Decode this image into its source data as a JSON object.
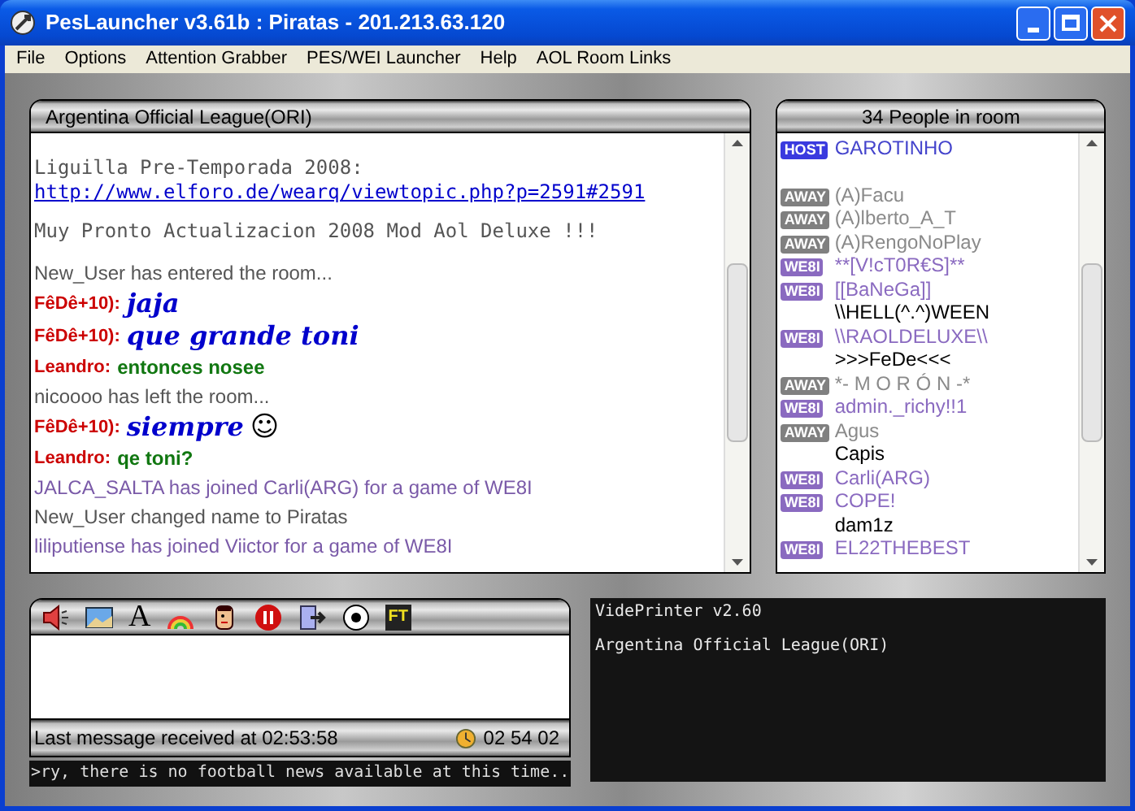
{
  "window": {
    "title": "PesLauncher v3.61b : Piratas - 201.213.63.120"
  },
  "menu": [
    "File",
    "Options",
    "Attention Grabber",
    "PES/WEI Launcher",
    "Help",
    "AOL Room Links"
  ],
  "chat": {
    "title": "Argentina Official League(ORI)",
    "messages": [
      {
        "kind": "announce",
        "text": "Liguilla Pre-Temporada 2008:",
        "link": "http://www.elforo.de/wearq/viewtopic.php?p=2591#2591"
      },
      {
        "kind": "announce",
        "text": "Muy Pronto Actualizacion 2008 Mod Aol Deluxe !!!"
      },
      {
        "kind": "system",
        "text": "New_User has entered the room..."
      },
      {
        "kind": "fancy",
        "user": "FêDê+10):",
        "text": "jaja"
      },
      {
        "kind": "fancy",
        "user": "FêDê+10):",
        "text": "que grande toni"
      },
      {
        "kind": "plain",
        "user": "Leandro:",
        "text": "entonces nosee"
      },
      {
        "kind": "system",
        "text": "nicoooo has left the room..."
      },
      {
        "kind": "fancy",
        "user": "FêDê+10):",
        "text": "siempre",
        "emoticon": "☺"
      },
      {
        "kind": "plain",
        "user": "Leandro:",
        "text": "qe toni?"
      },
      {
        "kind": "game",
        "text": "JALCA_SALTA has joined Carli(ARG) for a game of WE8I"
      },
      {
        "kind": "system",
        "text": "New_User changed name to Piratas"
      },
      {
        "kind": "game",
        "text": "liliputiense has joined Viictor for a game of WE8I"
      }
    ]
  },
  "people": {
    "title": "34 People in room",
    "users": [
      {
        "badge": "HOST",
        "kind": "host",
        "name": "GAROTINHO"
      },
      {
        "kind": "spacer"
      },
      {
        "badge": "AWAY",
        "kind": "away",
        "name": "(A)Facu"
      },
      {
        "badge": "AWAY",
        "kind": "away",
        "name": "(A)lberto_A_T"
      },
      {
        "badge": "AWAY",
        "kind": "away",
        "name": "(A)RengoNoPlay"
      },
      {
        "badge": "WE8I",
        "kind": "playing",
        "name": "**[V!cT0R€S]**"
      },
      {
        "badge": "WE8I",
        "kind": "playing",
        "name": "[[BaNeGa]]"
      },
      {
        "kind": "idle",
        "name": "\\\\HELL(^.^)WEEN"
      },
      {
        "badge": "WE8I",
        "kind": "playing",
        "name": "\\\\RAOLDELUXE\\\\"
      },
      {
        "kind": "idle",
        "name": ">>>FeDe<<<"
      },
      {
        "badge": "AWAY",
        "kind": "away",
        "name": "*- M O R Ó N -*"
      },
      {
        "badge": "WE8I",
        "kind": "playing",
        "name": "admin._richy!!1"
      },
      {
        "badge": "AWAY",
        "kind": "away",
        "name": "Agus"
      },
      {
        "kind": "idle",
        "name": "Capis"
      },
      {
        "badge": "WE8I",
        "kind": "playing",
        "name": "Carli(ARG)"
      },
      {
        "badge": "WE8I",
        "kind": "playing",
        "name": "COPE!"
      },
      {
        "kind": "idle",
        "name": "dam1z"
      },
      {
        "badge": "WE8I",
        "kind": "playing",
        "name": "EL22THEBEST"
      }
    ]
  },
  "input_panel": {
    "toolbar": {
      "font_glyph": "A",
      "ft_label": "FT"
    },
    "status": "Last message received at 02:53:58",
    "clock": "02 54 02",
    "ticker": ">ry, there is no football news available at this time.."
  },
  "videprinter": {
    "lines": [
      "VidePrinter v2.60",
      "Argentina Official League(ORI)"
    ]
  }
}
